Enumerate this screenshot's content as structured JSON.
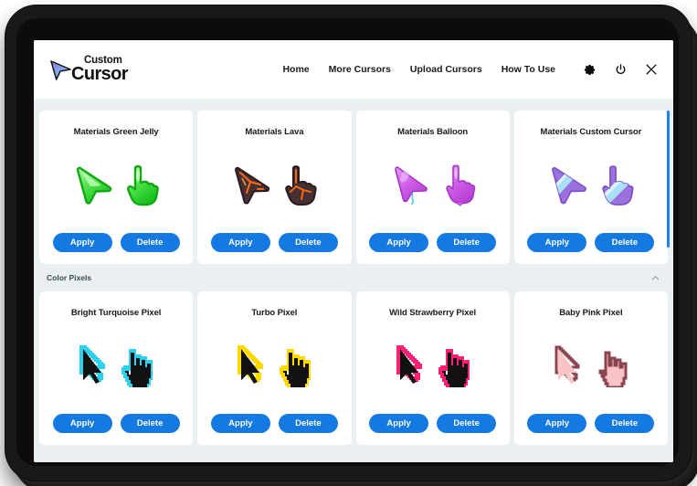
{
  "app": {
    "logo": {
      "line1": "Custom",
      "line2": "Cursor",
      "icon": "cursor-arrow-logo-icon"
    },
    "accent_color": "#1479E0",
    "background_color": "#eaeff2",
    "card_color": "#ffffff",
    "scrollbar_color": "#1A85F0"
  },
  "nav": {
    "links": [
      {
        "label": "Home",
        "name": "nav-home"
      },
      {
        "label": "More Cursors",
        "name": "nav-more-cursors"
      },
      {
        "label": "Upload Cursors",
        "name": "nav-upload-cursors"
      },
      {
        "label": "How To Use",
        "name": "nav-how-to-use"
      }
    ],
    "icons": [
      {
        "name": "gear-icon",
        "label": "Settings"
      },
      {
        "name": "power-icon",
        "label": "Power"
      },
      {
        "name": "close-icon",
        "label": "Close"
      }
    ]
  },
  "buttons": {
    "apply": "Apply",
    "delete": "Delete"
  },
  "sections": [
    {
      "name": "materials-section",
      "title": null,
      "cards": [
        {
          "title": "Materials Green Jelly",
          "style": "jelly",
          "color": "#3ee03e",
          "color2": "#a8f5a8"
        },
        {
          "title": "Materials Lava",
          "style": "lava",
          "color": "#4a3535",
          "color2": "#ff6a10"
        },
        {
          "title": "Materials Balloon",
          "style": "balloon",
          "color": "#c659e0",
          "color2": "#e79cf2"
        },
        {
          "title": "Materials Custom Cursor",
          "style": "custom",
          "color": "#9b72dd",
          "color2": "#a9e0f5"
        }
      ]
    },
    {
      "name": "color-pixels-section",
      "title": "Color Pixels",
      "collapse_icon": "chevron-up-icon",
      "cards": [
        {
          "title": "Bright Turquoise Pixel",
          "style": "pixel",
          "color": "#000000",
          "color2": "#2ad2f0"
        },
        {
          "title": "Turbo Pixel",
          "style": "pixel",
          "color": "#000000",
          "color2": "#ffd900"
        },
        {
          "title": "Wild Strawberry Pixel",
          "style": "pixel",
          "color": "#000000",
          "color2": "#ff1f74"
        },
        {
          "title": "Baby Pink Pixel",
          "style": "pixel",
          "color": "#fac3c6",
          "color2": "#8a4450"
        }
      ]
    }
  ]
}
